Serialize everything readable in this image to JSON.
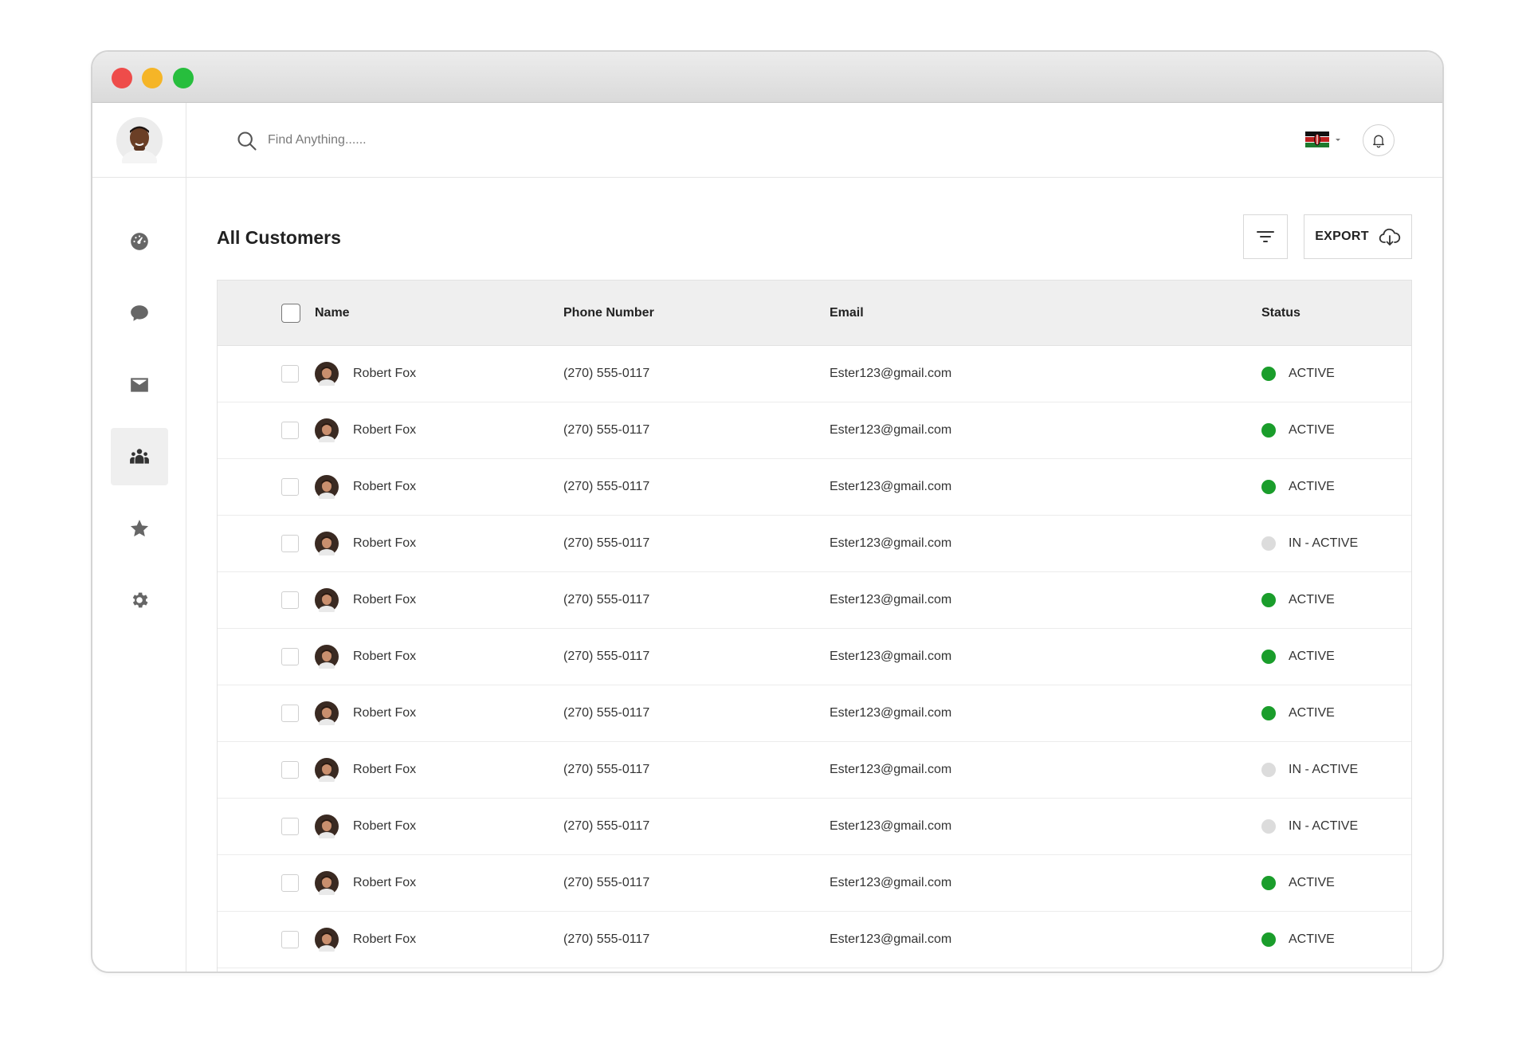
{
  "search": {
    "placeholder": "Find Anything......"
  },
  "page": {
    "title": "All Customers"
  },
  "toolbar": {
    "export_label": "EXPORT"
  },
  "table": {
    "columns": {
      "name": "Name",
      "phone": "Phone Number",
      "email": "Email",
      "status": "Status"
    },
    "rows": [
      {
        "name": "Robert Fox",
        "phone": "(270) 555-0117",
        "email": "Ester123@gmail.com",
        "status": "ACTIVE"
      },
      {
        "name": "Robert Fox",
        "phone": "(270) 555-0117",
        "email": "Ester123@gmail.com",
        "status": "ACTIVE"
      },
      {
        "name": "Robert Fox",
        "phone": "(270) 555-0117",
        "email": "Ester123@gmail.com",
        "status": "ACTIVE"
      },
      {
        "name": "Robert Fox",
        "phone": "(270) 555-0117",
        "email": "Ester123@gmail.com",
        "status": "IN - ACTIVE"
      },
      {
        "name": "Robert Fox",
        "phone": "(270) 555-0117",
        "email": "Ester123@gmail.com",
        "status": "ACTIVE"
      },
      {
        "name": "Robert Fox",
        "phone": "(270) 555-0117",
        "email": "Ester123@gmail.com",
        "status": "ACTIVE"
      },
      {
        "name": "Robert Fox",
        "phone": "(270) 555-0117",
        "email": "Ester123@gmail.com",
        "status": "ACTIVE"
      },
      {
        "name": "Robert Fox",
        "phone": "(270) 555-0117",
        "email": "Ester123@gmail.com",
        "status": "IN - ACTIVE"
      },
      {
        "name": "Robert Fox",
        "phone": "(270) 555-0117",
        "email": "Ester123@gmail.com",
        "status": "IN - ACTIVE"
      },
      {
        "name": "Robert Fox",
        "phone": "(270) 555-0117",
        "email": "Ester123@gmail.com",
        "status": "ACTIVE"
      },
      {
        "name": "Robert Fox",
        "phone": "(270) 555-0117",
        "email": "Ester123@gmail.com",
        "status": "ACTIVE"
      }
    ]
  },
  "sidebar": {
    "items": [
      {
        "icon": "dashboard-gauge-icon",
        "active": false
      },
      {
        "icon": "chat-bubble-icon",
        "active": false
      },
      {
        "icon": "mail-icon",
        "active": false
      },
      {
        "icon": "customers-group-icon",
        "active": true
      },
      {
        "icon": "star-icon",
        "active": false
      },
      {
        "icon": "settings-gear-icon",
        "active": false
      }
    ]
  },
  "colors": {
    "status_active": "#1a9d2b",
    "status_inactive": "#dcdcdc",
    "active_nav_bg": "#efefef",
    "traffic_red": "#ee4c4a",
    "traffic_yellow": "#f5b527",
    "traffic_green": "#27be3d"
  }
}
